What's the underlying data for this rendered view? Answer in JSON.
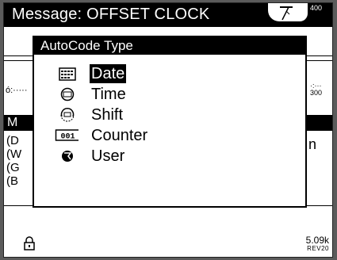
{
  "titlebar": {
    "title": "Message: OFFSET CLOCK",
    "corner_number": "400"
  },
  "background": {
    "ruler_left": "ó:·····",
    "ruler_right": "·:···\n300",
    "section_bar_label": "M",
    "left_labels": [
      "(D",
      "(W",
      "(G",
      "(B"
    ],
    "right_label": "n"
  },
  "dialog": {
    "title": "AutoCode Type",
    "items": [
      {
        "label": "Date",
        "icon": "calendar-icon",
        "selected": true
      },
      {
        "label": "Time",
        "icon": "clock-icon",
        "selected": false
      },
      {
        "label": "Shift",
        "icon": "shift-clock-icon",
        "selected": false
      },
      {
        "label": "Counter",
        "icon": "counter-icon",
        "selected": false
      },
      {
        "label": "User",
        "icon": "user-icon",
        "selected": false
      }
    ]
  },
  "status": {
    "lock_icon": "lock-icon",
    "size": "5.09k",
    "revision": "REV20"
  },
  "colors": {
    "bezel": "#5b5b5b",
    "screen": "#ffffff",
    "ink": "#000000"
  }
}
